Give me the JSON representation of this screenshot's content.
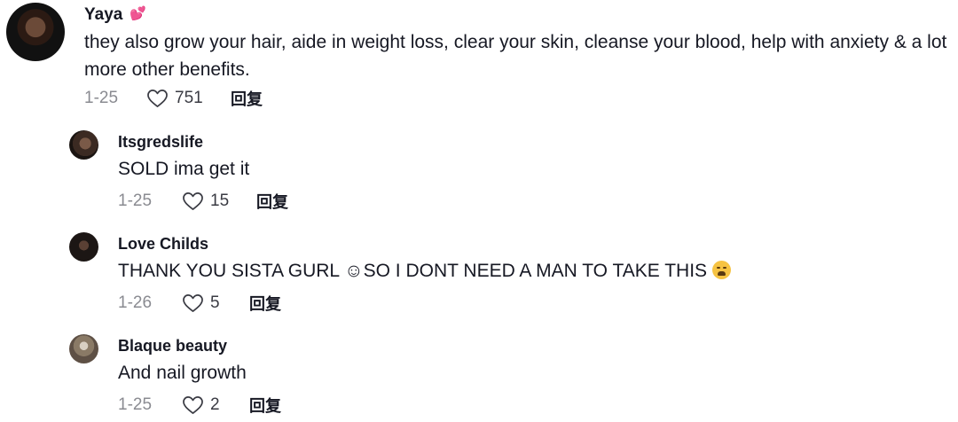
{
  "comments": [
    {
      "username": "Yaya",
      "badge": "💕",
      "text": "they also grow your hair, aide in weight loss, clear your skin, cleanse your blood, help with anxiety & a lot more other benefits.",
      "date": "1-25",
      "likes": "751",
      "reply_label": "回复"
    }
  ],
  "replies": [
    {
      "username": "Itsgredslife",
      "text": "SOLD ima get it",
      "date": "1-25",
      "likes": "15",
      "reply_label": "回复"
    },
    {
      "username": "Love Childs",
      "text": "THANK YOU SISTA GURL ☺SO I DONT NEED A MAN TO TAKE THIS",
      "date": "1-26",
      "likes": "5",
      "reply_label": "回复"
    },
    {
      "username": "Blaque beauty",
      "text": "And nail growth",
      "date": "1-25",
      "likes": "2",
      "reply_label": "回复"
    }
  ],
  "icons": {
    "like": "heart-outline-icon",
    "weary_emoji": "weary-face-emoji-icon"
  },
  "colors": {
    "text": "#161823",
    "meta": "#8a8b91",
    "background": "#ffffff"
  }
}
